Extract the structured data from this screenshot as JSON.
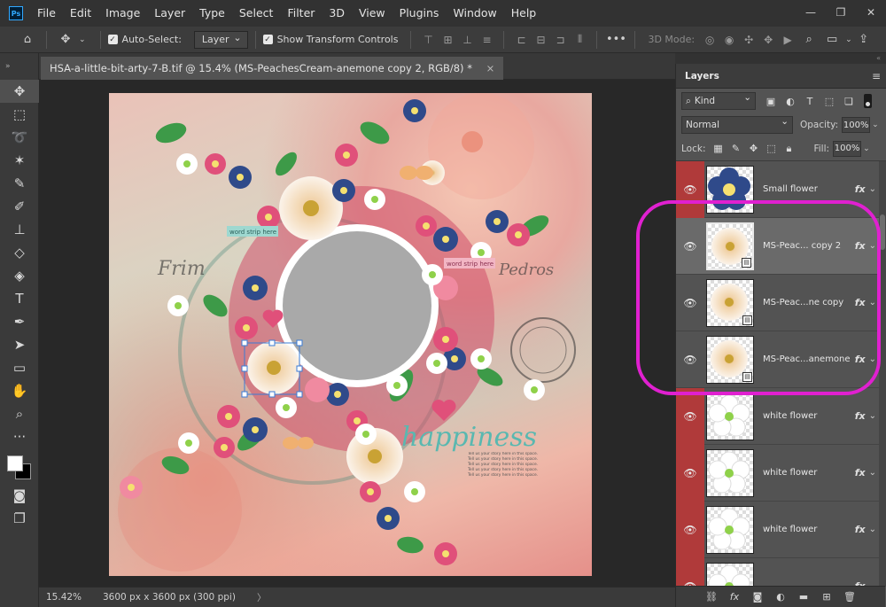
{
  "app": {
    "logo": "Ps"
  },
  "menu": [
    "File",
    "Edit",
    "Image",
    "Layer",
    "Type",
    "Select",
    "Filter",
    "3D",
    "View",
    "Plugins",
    "Window",
    "Help"
  ],
  "window_controls": {
    "minimize": "—",
    "restore": "❐",
    "close": "✕"
  },
  "options": {
    "auto_select_label": "Auto-Select:",
    "auto_select_target": "Layer",
    "show_transform_label": "Show Transform Controls",
    "more": "•••",
    "three_d_mode_label": "3D Mode:"
  },
  "document": {
    "tab_title": "HSA-a-little-bit-arty-7-B.tif @ 15.4% (MS-PeachesCream-anemone copy 2, RGB/8) *",
    "close_glyph": "×"
  },
  "status": {
    "zoom": "15.42%",
    "doc_size": "3600 px x 3600 px (300 ppi)",
    "arrow": "〉"
  },
  "layers_panel": {
    "tab_label": "Layers",
    "kind_label": "Kind",
    "blend_mode": "Normal",
    "opacity_label": "Opacity:",
    "opacity_value": "100%",
    "lock_label": "Lock:",
    "fill_label": "Fill:",
    "fill_value": "100%",
    "fx_label": "fx",
    "layers": [
      {
        "name": "Small flower",
        "thumb": "small-flower",
        "red_eye": true,
        "selected": false,
        "smart": false
      },
      {
        "name": "MS-Peac... copy 2",
        "thumb": "anemone",
        "red_eye": false,
        "selected": true,
        "smart": true
      },
      {
        "name": "MS-Peac...ne copy",
        "thumb": "anemone",
        "red_eye": false,
        "selected": false,
        "smart": true
      },
      {
        "name": "MS-Peac...anemone",
        "thumb": "anemone",
        "red_eye": false,
        "selected": false,
        "smart": true
      },
      {
        "name": "white flower",
        "thumb": "white-flower",
        "red_eye": true,
        "selected": false,
        "smart": false
      },
      {
        "name": "white flower",
        "thumb": "white-flower",
        "red_eye": true,
        "selected": false,
        "smart": false
      },
      {
        "name": "white flower",
        "thumb": "white-flower",
        "red_eye": true,
        "selected": false,
        "smart": false
      },
      {
        "name": "",
        "thumb": "white-flower",
        "red_eye": true,
        "selected": false,
        "smart": false
      }
    ]
  },
  "artwork": {
    "word_strip_1": "word strip here",
    "word_strip_2": "word strip here",
    "script_left": "Frim",
    "script_right": "Pedros",
    "title_text": "happiness",
    "journal_text": "Tell us your story here in this space. Tell us your story here in this space. Tell us your story here in this space. Tell us your story here in this space. Tell us your story here in this space.",
    "colors": {
      "navy": "#2f4a8a",
      "pink": "#e0507a",
      "green": "#3f9a4a",
      "cream": "#f7ead6",
      "teal": "#59b8b0"
    }
  }
}
